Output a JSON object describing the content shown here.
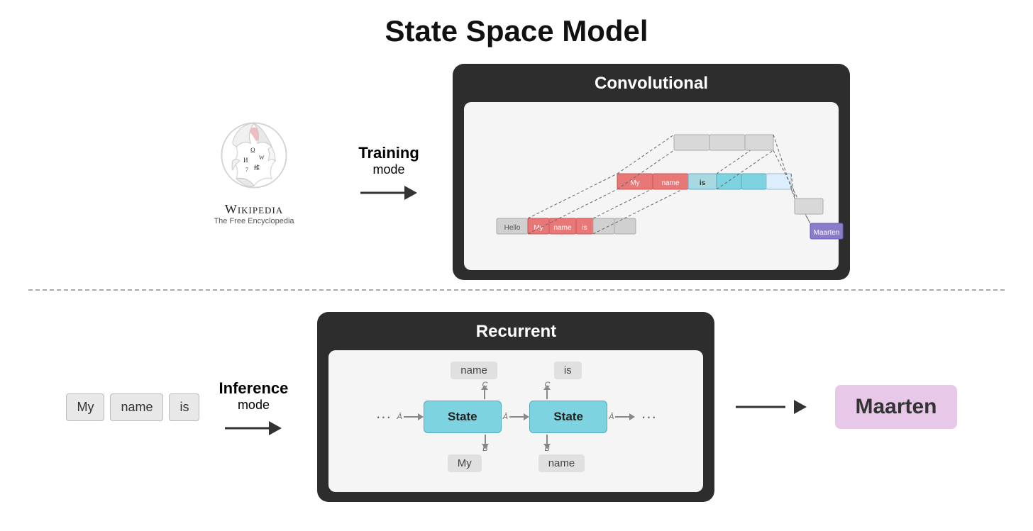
{
  "page": {
    "title": "State Space Model",
    "top_section": {
      "mode_label": "Training",
      "mode_sub": "mode",
      "panel_title": "Convolutional"
    },
    "bottom_section": {
      "mode_label": "Inference",
      "mode_sub": "mode",
      "panel_title": "Recurrent",
      "input_tokens": [
        "My",
        "name",
        "is"
      ],
      "output_label": "Maarten",
      "top_labels": [
        "name",
        "is"
      ],
      "bottom_labels": [
        "My",
        "name"
      ],
      "state_label": "State"
    },
    "wikipedia": {
      "title": "Wikipedia",
      "subtitle": "The Free Encyclopedia"
    }
  }
}
